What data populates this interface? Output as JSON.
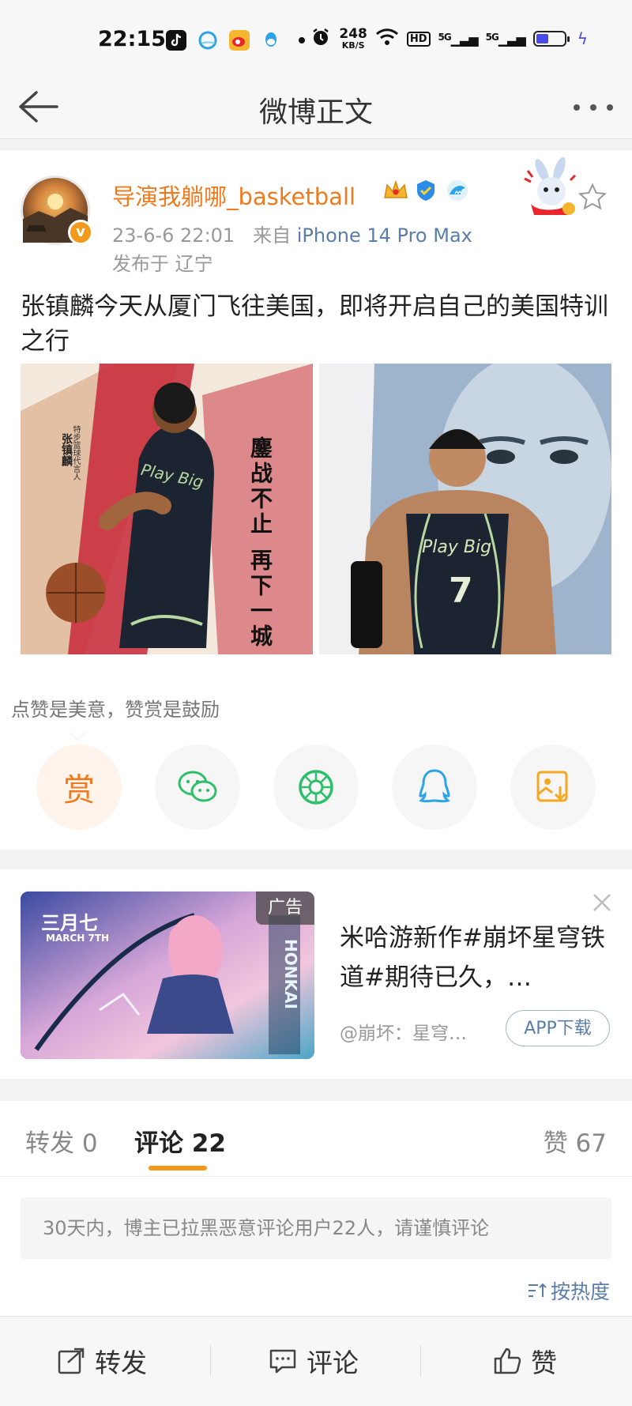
{
  "status_bar": {
    "time": "22:15",
    "net_speed_value": "248",
    "net_speed_unit": "KB/S",
    "hd_label": "HD",
    "signal1": "5G",
    "signal2": "5G",
    "battery_level": 0.45,
    "icons": [
      "tiktok-icon",
      "browser-icon",
      "weibo-icon",
      "qq-icon",
      "dot-icon",
      "alarm-icon",
      "wifi-icon",
      "battery-icon",
      "charging-icon"
    ]
  },
  "nav": {
    "title": "微博正文"
  },
  "post": {
    "username": "导演我躺哪_basketball",
    "date": "23-6-6 22:01",
    "source_prefix": "来自",
    "source": "iPhone 14 Pro Max",
    "location": "发布于 辽宁",
    "text": "张镇麟今天从厦门飞往美国，即将开启自己的美国特训之行",
    "image1_text": {
      "slogan": "鏖战不止 再下一城",
      "small": "特步篮球代言人",
      "name": "张镇麟",
      "jersey": "Play Big"
    },
    "image2_text": {
      "jersey": "Play Big",
      "number": "7"
    }
  },
  "reward": {
    "tip": "点赞是美意，赞赏是鼓励",
    "reward_label": "赏"
  },
  "ad": {
    "tag": "广告",
    "title": "米哈游新作#崩坏星穹铁道#期待已久，…",
    "source": "@崩坏：星穹…",
    "button": "APP下载",
    "image_title_cn": "三月七",
    "image_title_en": "MARCH 7TH",
    "image_logo": "HONKAI"
  },
  "comments": {
    "tab_reposts": "转发 0",
    "tab_comments": "评论 22",
    "tab_likes": "赞 67",
    "notice": "30天内，博主已拉黑恶意评论用户22人，请谨慎评论",
    "sort": "按热度"
  },
  "bottom_bar": {
    "repost": "转发",
    "comment": "评论",
    "like": "赞"
  },
  "colors": {
    "accent_orange": "#f07a1e",
    "link_blue": "#5a7ea8",
    "underline": "#f39a1c"
  }
}
